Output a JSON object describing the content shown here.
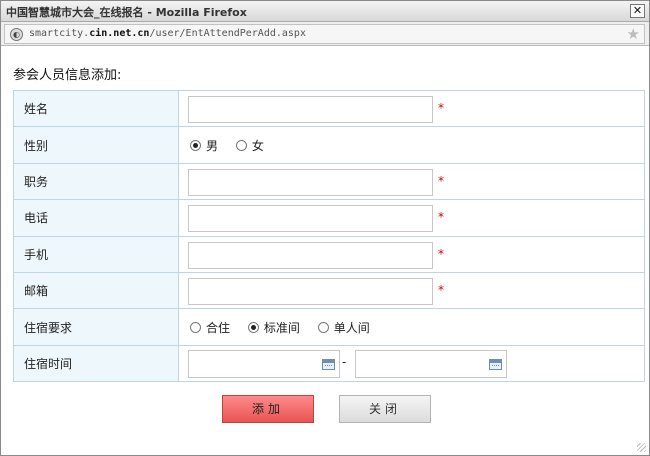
{
  "window": {
    "title": "中国智慧城市大会_在线报名 - Mozilla Firefox",
    "close_glyph": "✕"
  },
  "address_bar": {
    "url_prefix": "smartcity.",
    "url_domain": "cin.net.cn",
    "url_path": "/user/EntAttendPerAdd.aspx",
    "icons": [
      "site-identity-icon",
      "bookmark-star-icon"
    ]
  },
  "form": {
    "heading": "参会人员信息添加:",
    "required_mark": "*",
    "labels": {
      "name": "姓名",
      "gender": "性别",
      "position": "职务",
      "phone": "电话",
      "mobile": "手机",
      "email": "邮箱",
      "lodging": "住宿要求",
      "lodging_time": "住宿时间"
    },
    "gender_options": [
      {
        "label": "男",
        "selected": true
      },
      {
        "label": "女",
        "selected": false
      }
    ],
    "lodging_options": [
      {
        "label": "合住",
        "selected": false
      },
      {
        "label": "标准间",
        "selected": true
      },
      {
        "label": "单人间",
        "selected": false
      }
    ],
    "date_separator": "-",
    "values": {
      "name": "",
      "position": "",
      "phone": "",
      "mobile": "",
      "email": "",
      "lodging_start": "",
      "lodging_end": ""
    }
  },
  "buttons": {
    "add": "添加",
    "close": "关闭"
  },
  "colors": {
    "label_bg": "#eef7fb",
    "border": "#bcd7e3",
    "required": "#d40000",
    "add_button": "#e85454"
  }
}
